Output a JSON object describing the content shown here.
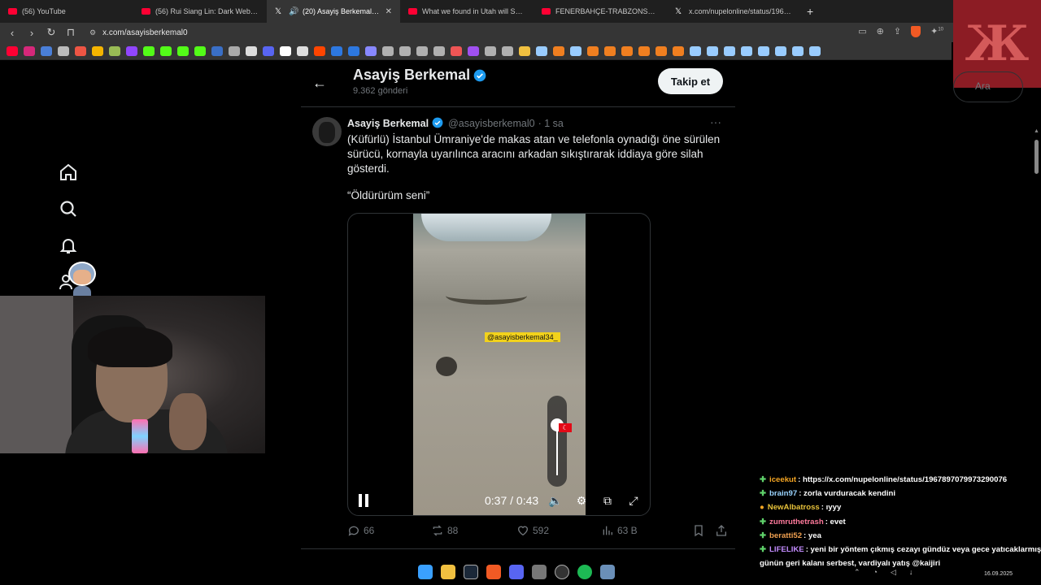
{
  "browser": {
    "tabs": [
      {
        "label": "(56) YouTube",
        "icon": "youtube-icon",
        "active": false
      },
      {
        "label": "(56) Rui Siang Lin: Dark Web Baronu",
        "icon": "youtube-icon",
        "active": false
      },
      {
        "label": "(20) Asayiş Berkemal (@asayi",
        "icon": "x-icon",
        "active": true
      },
      {
        "label": "What we found in Utah will SHOCK y",
        "icon": "youtube-icon",
        "active": false
      },
      {
        "label": "FENERBAHÇE-TRABZONSPOR @Kad",
        "icon": "youtube-icon",
        "active": false
      },
      {
        "label": "x.com/nupelonline/status/19678970",
        "icon": "x-icon",
        "active": false
      }
    ],
    "new_tab": "+",
    "url": "x.com/asayisberkemal0",
    "extension_badge": "10"
  },
  "sidebar": {
    "search_placeholder": "Ara",
    "nav": [
      {
        "name": "home-icon"
      },
      {
        "name": "search-icon"
      },
      {
        "name": "notifications-icon"
      },
      {
        "name": "follow-icon"
      }
    ]
  },
  "profile_header": {
    "name": "Asayiş Berkemal",
    "posts": "9.362 gönderi",
    "follow_label": "Takip et"
  },
  "tweet": {
    "author": "Asayiş Berkemal",
    "handle": "@asayisberkemal0",
    "time": "· 1 sa",
    "more": "···",
    "text": "(Küfürlü) İstanbul Ümraniye'de makas atan ve telefonla oynadığı öne sürülen sürücü, kornayla uyarılınca aracını arkadan sıkıştırarak iddiaya göre silah gösterdi.",
    "quote": "“Öldürürüm seni”",
    "video": {
      "watermark": "@asayisberkemal34_",
      "time": "0:37 / 0:43",
      "progress": 0.86,
      "volume": 0.8
    },
    "stats": {
      "replies": "66",
      "reposts": "88",
      "likes": "592",
      "views": "63 B"
    }
  },
  "chat": [
    {
      "user": "iceekut",
      "user_color": "#f6a623",
      "message": ": https://x.com/nupelonline/status/1967897079973290076"
    },
    {
      "user": "brain97",
      "user_color": "#9ad4ff",
      "message": ": zorla vurduracak kendini"
    },
    {
      "user": "NewAlbatross",
      "user_color": "#e8c23a",
      "message": ": ıyyy"
    },
    {
      "user": "zumruthetrash",
      "user_color": "#ff7a9c",
      "message": ": evet"
    },
    {
      "user": "beratti52",
      "user_color": "#f0a050",
      "message": ": yea"
    },
    {
      "user": "LIFELIKE",
      "user_color": "#c38cff",
      "message": ": yeni bir yöntem çıkmış cezayı gündüz veya gece yatıcaklarmış"
    },
    {
      "user": "",
      "user_color": "#ffffff",
      "message": "günün geri kalanı serbest, vardiyalı yatış @kaijiri"
    }
  ],
  "system": {
    "date": "16.09.2025"
  },
  "colors": {
    "accent": "#1d9bf0",
    "background": "#000000",
    "text_muted": "#71767b"
  }
}
